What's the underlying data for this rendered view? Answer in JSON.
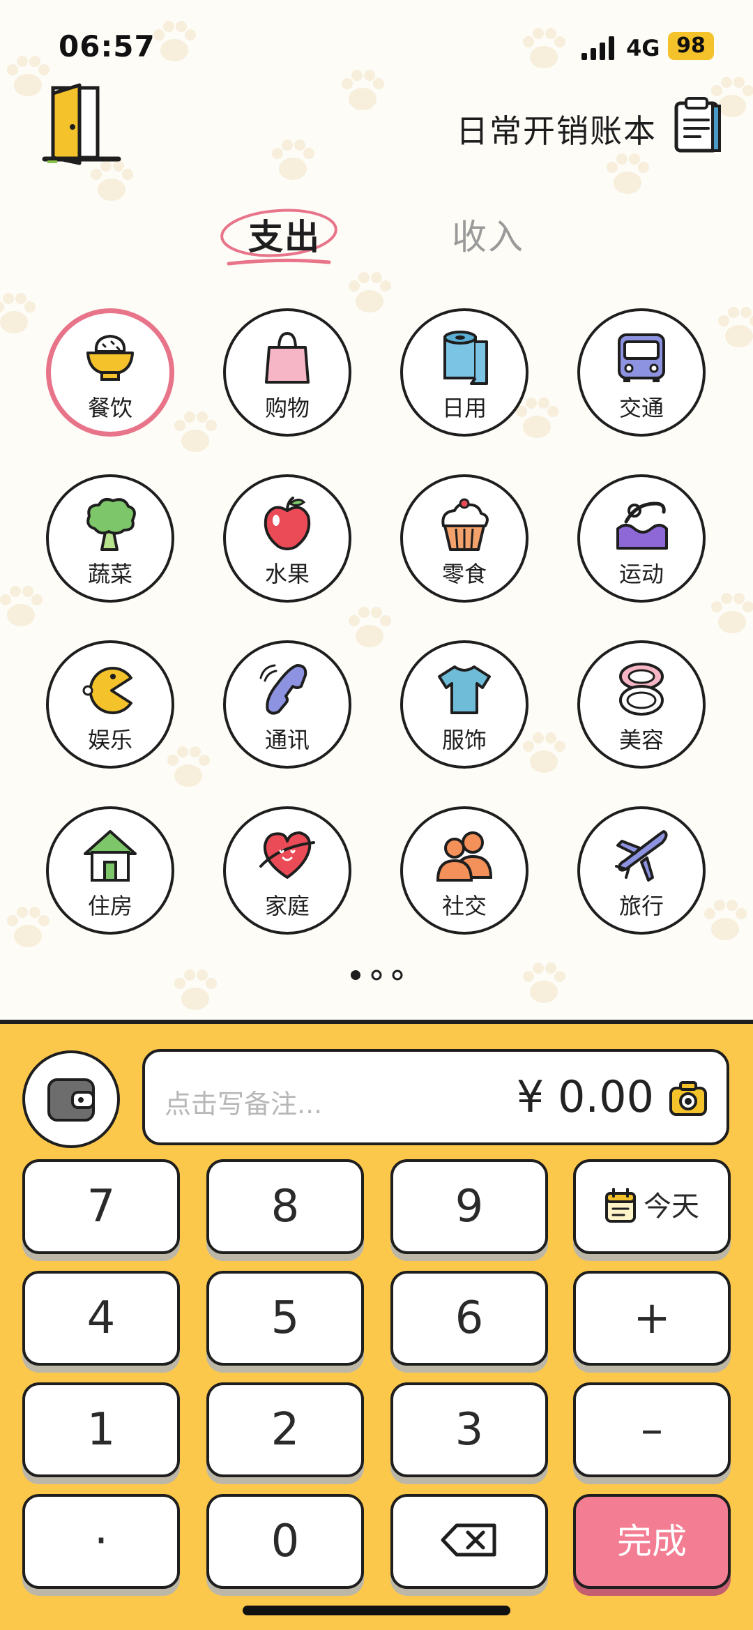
{
  "status": {
    "time": "06:57",
    "network": "4G",
    "battery": "98"
  },
  "header": {
    "title": "日常开销账本"
  },
  "tabs": {
    "expense": "支出",
    "income": "收入"
  },
  "categories": [
    {
      "label": "餐饮",
      "icon": "rice-bowl-icon"
    },
    {
      "label": "购物",
      "icon": "shopping-bag-icon"
    },
    {
      "label": "日用",
      "icon": "tissue-roll-icon"
    },
    {
      "label": "交通",
      "icon": "bus-icon"
    },
    {
      "label": "蔬菜",
      "icon": "broccoli-icon"
    },
    {
      "label": "水果",
      "icon": "apple-icon"
    },
    {
      "label": "零食",
      "icon": "cupcake-icon"
    },
    {
      "label": "运动",
      "icon": "swimmer-icon"
    },
    {
      "label": "娱乐",
      "icon": "pacman-icon"
    },
    {
      "label": "通讯",
      "icon": "phone-icon"
    },
    {
      "label": "服饰",
      "icon": "tshirt-icon"
    },
    {
      "label": "美容",
      "icon": "compact-mirror-icon"
    },
    {
      "label": "住房",
      "icon": "house-icon"
    },
    {
      "label": "家庭",
      "icon": "heart-planet-icon"
    },
    {
      "label": "社交",
      "icon": "people-icon"
    },
    {
      "label": "旅行",
      "icon": "airplane-icon"
    }
  ],
  "input": {
    "placeholder": "点击写备注...",
    "amount": "¥ 0.00"
  },
  "keypad": {
    "k7": "7",
    "k8": "8",
    "k9": "9",
    "today": "今天",
    "k4": "4",
    "k5": "5",
    "k6": "6",
    "plus": "+",
    "k1": "1",
    "k2": "2",
    "k3": "3",
    "minus": "–",
    "dot": "·",
    "k0": "0",
    "done": "完成"
  },
  "colors": {
    "panel": "#fcc84c",
    "accent_pink": "#e8748a",
    "done": "#f37d92"
  }
}
